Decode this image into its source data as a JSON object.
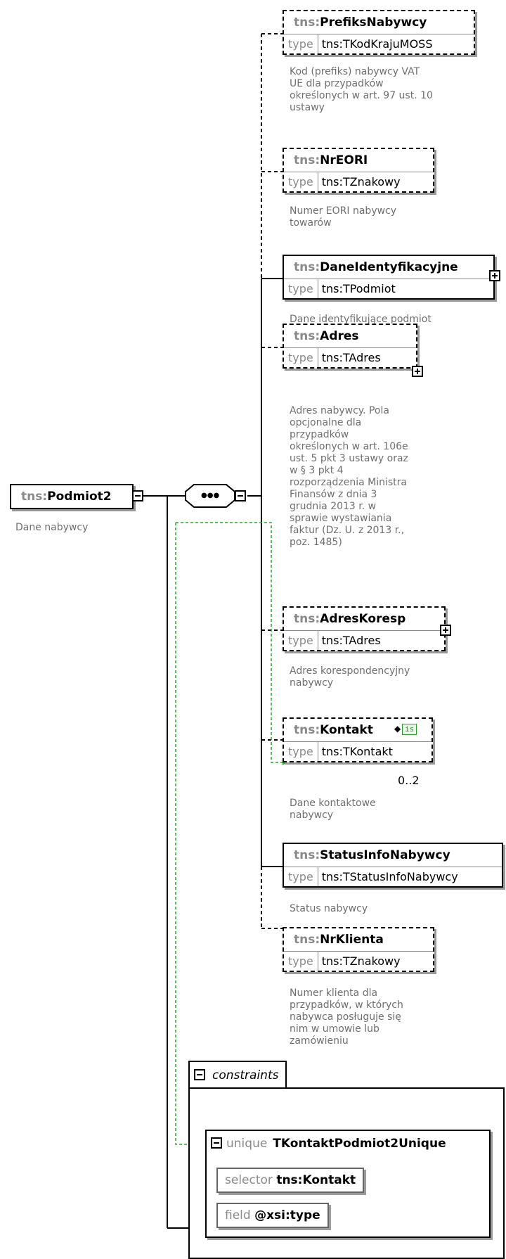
{
  "root": {
    "prefix": "tns:",
    "name": "Podmiot2",
    "doc": "Dane nabywcy"
  },
  "type_label": "type",
  "children": [
    {
      "prefix": "tns:",
      "name": "PrefiksNabywcy",
      "type": "tns:TKodKrajuMOSS",
      "doc": [
        "Kod (prefiks) nabywcy VAT",
        "UE dla przypadków",
        "określonych w art. 97 ust. 10",
        "ustawy"
      ]
    },
    {
      "prefix": "tns:",
      "name": "NrEORI",
      "type": "tns:TZnakowy",
      "doc": [
        "Numer EORI nabywcy",
        "towarów"
      ]
    },
    {
      "prefix": "tns:",
      "name": "DaneIdentyfikacyjne",
      "type": "tns:TPodmiot",
      "doc": [
        "Dane identyfikujące podmiot"
      ]
    },
    {
      "prefix": "tns:",
      "name": "Adres",
      "type": "tns:TAdres",
      "doc": [
        "Adres nabywcy. Pola",
        "opcjonalne dla",
        "przypadków",
        "określonych w art. 106e",
        "ust. 5 pkt 3 ustawy oraz",
        "w § 3 pkt 4",
        "rozporządzenia Ministra",
        "Finansów z dnia 3",
        "grudnia 2013 r. w",
        "sprawie wystawiania",
        "faktur (Dz. U. z 2013 r.,",
        "poz. 1485)"
      ]
    },
    {
      "prefix": "tns:",
      "name": "AdresKoresp",
      "type": "tns:TAdres",
      "doc": [
        "Adres korespondencyjny",
        "nabywcy"
      ]
    },
    {
      "prefix": "tns:",
      "name": "Kontakt",
      "type": "tns:TKontakt",
      "cardinality": "0..2",
      "id_badge": "is",
      "doc": [
        "Dane kontaktowe",
        "nabywcy"
      ]
    },
    {
      "prefix": "tns:",
      "name": "StatusInfoNabywcy",
      "type": "tns:TStatusInfoNabywcy",
      "doc": [
        "Status nabywcy"
      ]
    },
    {
      "prefix": "tns:",
      "name": "NrKlienta",
      "type": "tns:TZnakowy",
      "doc": [
        "Numer klienta dla",
        "przypadków, w których",
        "nabywca posługuje się",
        "nim w umowie lub",
        "zamówieniu"
      ]
    }
  ],
  "constraints": {
    "label": "constraints",
    "unique_keyword": "unique",
    "unique_name": "TKontaktPodmiot2Unique",
    "selector_keyword": "selector",
    "selector_value": "tns:Kontakt",
    "field_keyword": "field",
    "field_value": "@xsi:type"
  },
  "colors": {
    "keyref_line": "#22aa22",
    "prefix": "#8a8a8a",
    "doc": "#6f6f6f"
  }
}
